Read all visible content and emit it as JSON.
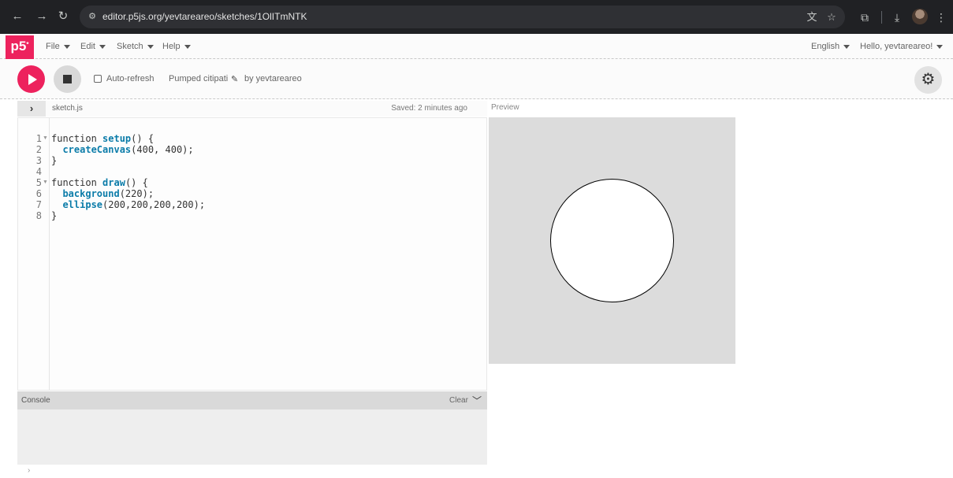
{
  "browser": {
    "url": "editor.p5js.org/yevtareareo/sketches/1OlITmNTK"
  },
  "menu": {
    "logo": "p5",
    "items": [
      {
        "label": "File"
      },
      {
        "label": "Edit"
      },
      {
        "label": "Sketch"
      },
      {
        "label": "Help"
      }
    ],
    "language": "English",
    "greeting": "Hello, yevtareareo!"
  },
  "toolbar": {
    "auto_refresh_label": "Auto-refresh",
    "auto_refresh_checked": false,
    "sketch_name": "Pumped citipati",
    "author": "by yevtareareo"
  },
  "editor": {
    "file_name": "sketch.js",
    "saved_status": "Saved: 2 minutes ago",
    "lines": [
      {
        "num": "1",
        "text": "function setup() {"
      },
      {
        "num": "2",
        "text": "  createCanvas(400, 400);"
      },
      {
        "num": "3",
        "text": "}"
      },
      {
        "num": "4",
        "text": ""
      },
      {
        "num": "5",
        "text": "function draw() {"
      },
      {
        "num": "6",
        "text": "  background(220);"
      },
      {
        "num": "7",
        "text": "  ellipse(200,200,200,200);"
      },
      {
        "num": "8",
        "text": "}"
      }
    ]
  },
  "console": {
    "title": "Console",
    "clear_label": "Clear",
    "prompt": "›"
  },
  "preview": {
    "label": "Preview",
    "canvas_bg": "#dcdcdc",
    "ellipse_fill": "#ffffff"
  },
  "colors": {
    "accent": "#ed225d"
  }
}
